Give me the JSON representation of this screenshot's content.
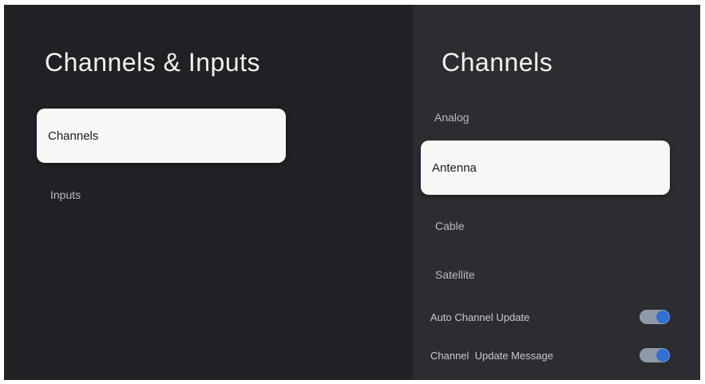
{
  "left_panel": {
    "title": "Channels & Inputs",
    "items": [
      {
        "label": "Channels",
        "selected": true
      },
      {
        "label": "Inputs",
        "selected": false
      }
    ]
  },
  "right_panel": {
    "title": "Channels",
    "items": [
      {
        "label": "Analog",
        "selected": false
      },
      {
        "label": "Antenna",
        "selected": true
      },
      {
        "label": "Cable",
        "selected": false
      },
      {
        "label": "Satellite",
        "selected": false
      }
    ],
    "toggles": [
      {
        "label": "Auto Channel Update",
        "on": true
      },
      {
        "label": "Channel  Update Message",
        "on": true
      }
    ]
  },
  "colors": {
    "left_background": "#1f2124",
    "right_background": "#2b2d31",
    "selected_background": "#f7f7f7",
    "toggle_knob": "#2f6fd6",
    "toggle_track": "#8f9aa8"
  }
}
